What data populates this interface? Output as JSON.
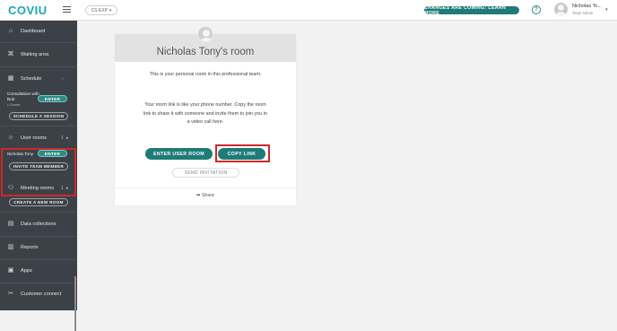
{
  "header": {
    "logo": "COVIU",
    "team_select": "CS EXP",
    "changes_button": "CHANGES ARE COMING: LEARN MORE",
    "help_icon": "?",
    "user_name": "Nicholas To...",
    "user_role": "Team Admin"
  },
  "sidebar": {
    "dashboard": "Dashboard",
    "waiting_area": "Waiting area",
    "schedule": "Schedule",
    "consultation_title": "Consultation with Bob",
    "consultation_status": "• Closed",
    "enter": "ENTER",
    "schedule_session": "SCHEDULE A SESSION",
    "user_rooms": "User rooms",
    "user_rooms_count": "1",
    "user_room_name": "Nicholas Tony",
    "invite_team_member": "INVITE TEAM MEMBER",
    "meeting_rooms": "Meeting rooms",
    "meeting_rooms_count": "1",
    "create_room": "CREATE A NEW ROOM",
    "data_collections": "Data collections",
    "reports": "Reports",
    "apps": "Apps",
    "customer_connect": "Customer connect"
  },
  "room": {
    "title": "Nicholas Tony's room",
    "intro": "This is your personal room in this professional team.",
    "description": "Your room link is like your phone number. Copy the room link to share it with someone and invite them to join you in a video call here.",
    "enter_button": "ENTER USER ROOM",
    "copy_button": "COPY LINK",
    "invite_button": "SEND INVITATION",
    "share": "Share"
  },
  "icons": {
    "dashboard": "home-icon",
    "waiting_area": "chair-icon",
    "schedule": "calendar-icon",
    "user_rooms": "user-icon",
    "meeting_rooms": "group-icon",
    "data_collections": "clipboard-icon",
    "reports": "report-icon",
    "apps": "apps-icon",
    "customer_connect": "connect-icon"
  },
  "colors": {
    "brand": "#1aa6b7",
    "primary_button": "#1e7b77",
    "sidebar": "#3c4148",
    "highlight": "#cc2a2a"
  }
}
